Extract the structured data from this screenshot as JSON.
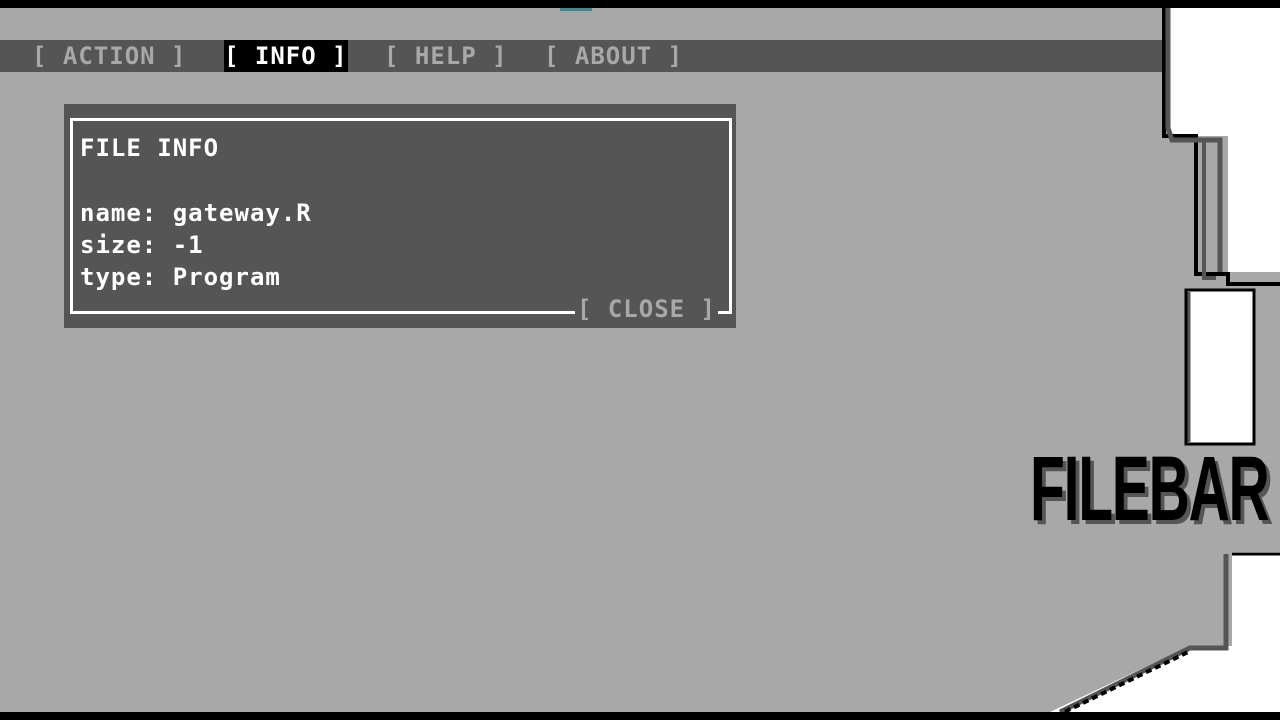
{
  "menu": {
    "items": [
      {
        "label": "[ ACTION ]",
        "active": false
      },
      {
        "label": "[ INFO ]",
        "active": true
      },
      {
        "label": "[ HELP ]",
        "active": false
      },
      {
        "label": "[ ABOUT ]",
        "active": false
      }
    ]
  },
  "dialog": {
    "title": "FILE INFO",
    "name_line": "name: gateway.R",
    "size_line": "size: -1",
    "type_line": "type: Program",
    "close_label": "[ CLOSE ]"
  },
  "logo": {
    "text": "FILEBAR"
  },
  "colors": {
    "background": "#a8a8a8",
    "menubar": "#555555",
    "dialog": "#555555",
    "active_menu": "#000000",
    "text": "#ffffff",
    "inactive_text": "#a8a8a8"
  }
}
